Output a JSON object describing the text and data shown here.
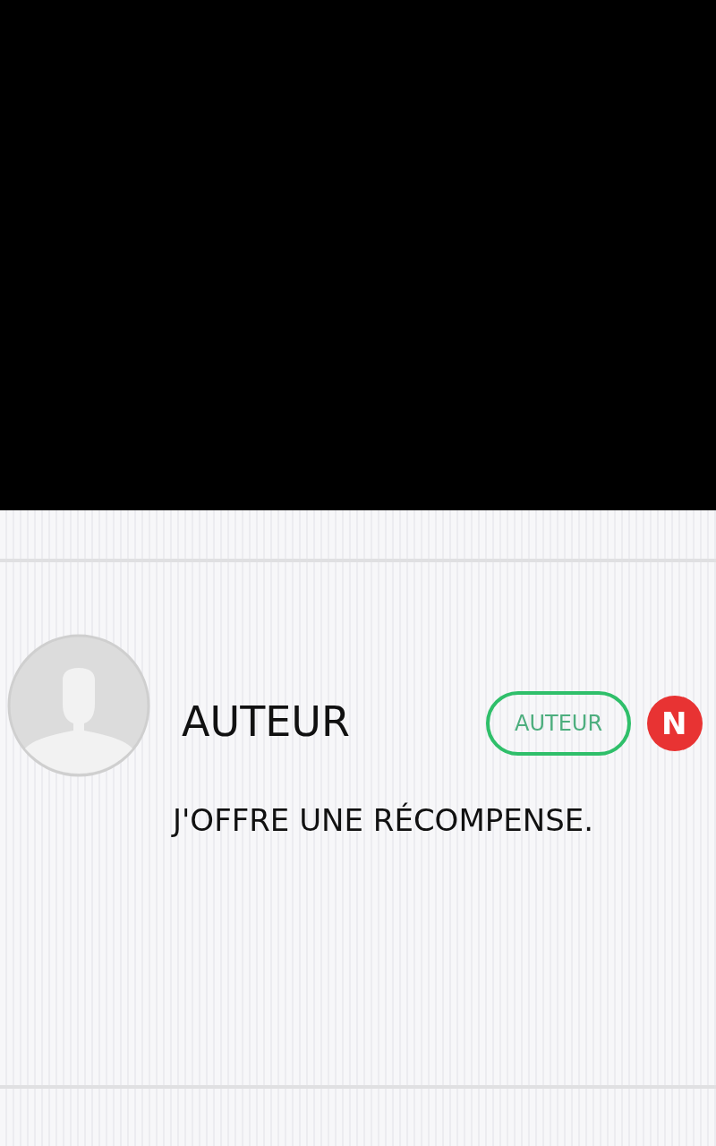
{
  "comment": {
    "author": "AUTEUR",
    "badge": "AUTEUR",
    "new_badge": "N",
    "text": "J'OFFRE UNE RÉCOMPENSE."
  }
}
